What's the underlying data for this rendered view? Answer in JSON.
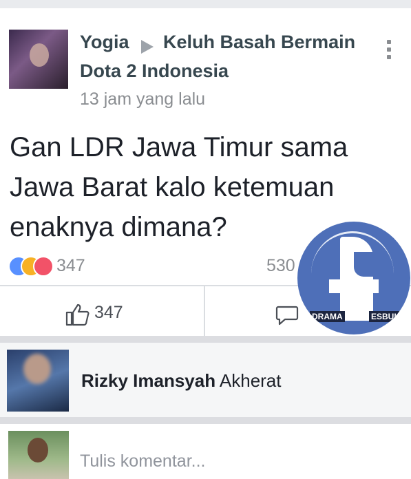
{
  "post": {
    "author": "Yogia",
    "group_line1": "Keluh Basah Bermain",
    "group_line2": "Dota 2 Indonesia",
    "time": "13 jam yang lalu",
    "text_line1": "Gan LDR Jawa Timur sama",
    "text_line2": "Jawa Barat kalo ketemuan",
    "text_line3": "enaknya dimana?"
  },
  "stats": {
    "reaction_count": "347",
    "comment_count": "530"
  },
  "actions": {
    "like_count": "347"
  },
  "badge": {
    "left_label": "DRAMA",
    "right_label": "ESBUK"
  },
  "comment": {
    "name": "Rizky Imansyah",
    "text": "Akherat"
  },
  "compose": {
    "placeholder": "Tulis komentar..."
  },
  "icons": [
    "like-reaction-icon",
    "haha-reaction-icon",
    "love-reaction-icon",
    "thumbs-up-icon",
    "comment-bubble-icon",
    "more-options-icon",
    "facebook-logo-icon"
  ],
  "colors": {
    "accent": "#4e6fb8",
    "text": "#1d2129",
    "meta": "#8a8d91"
  }
}
